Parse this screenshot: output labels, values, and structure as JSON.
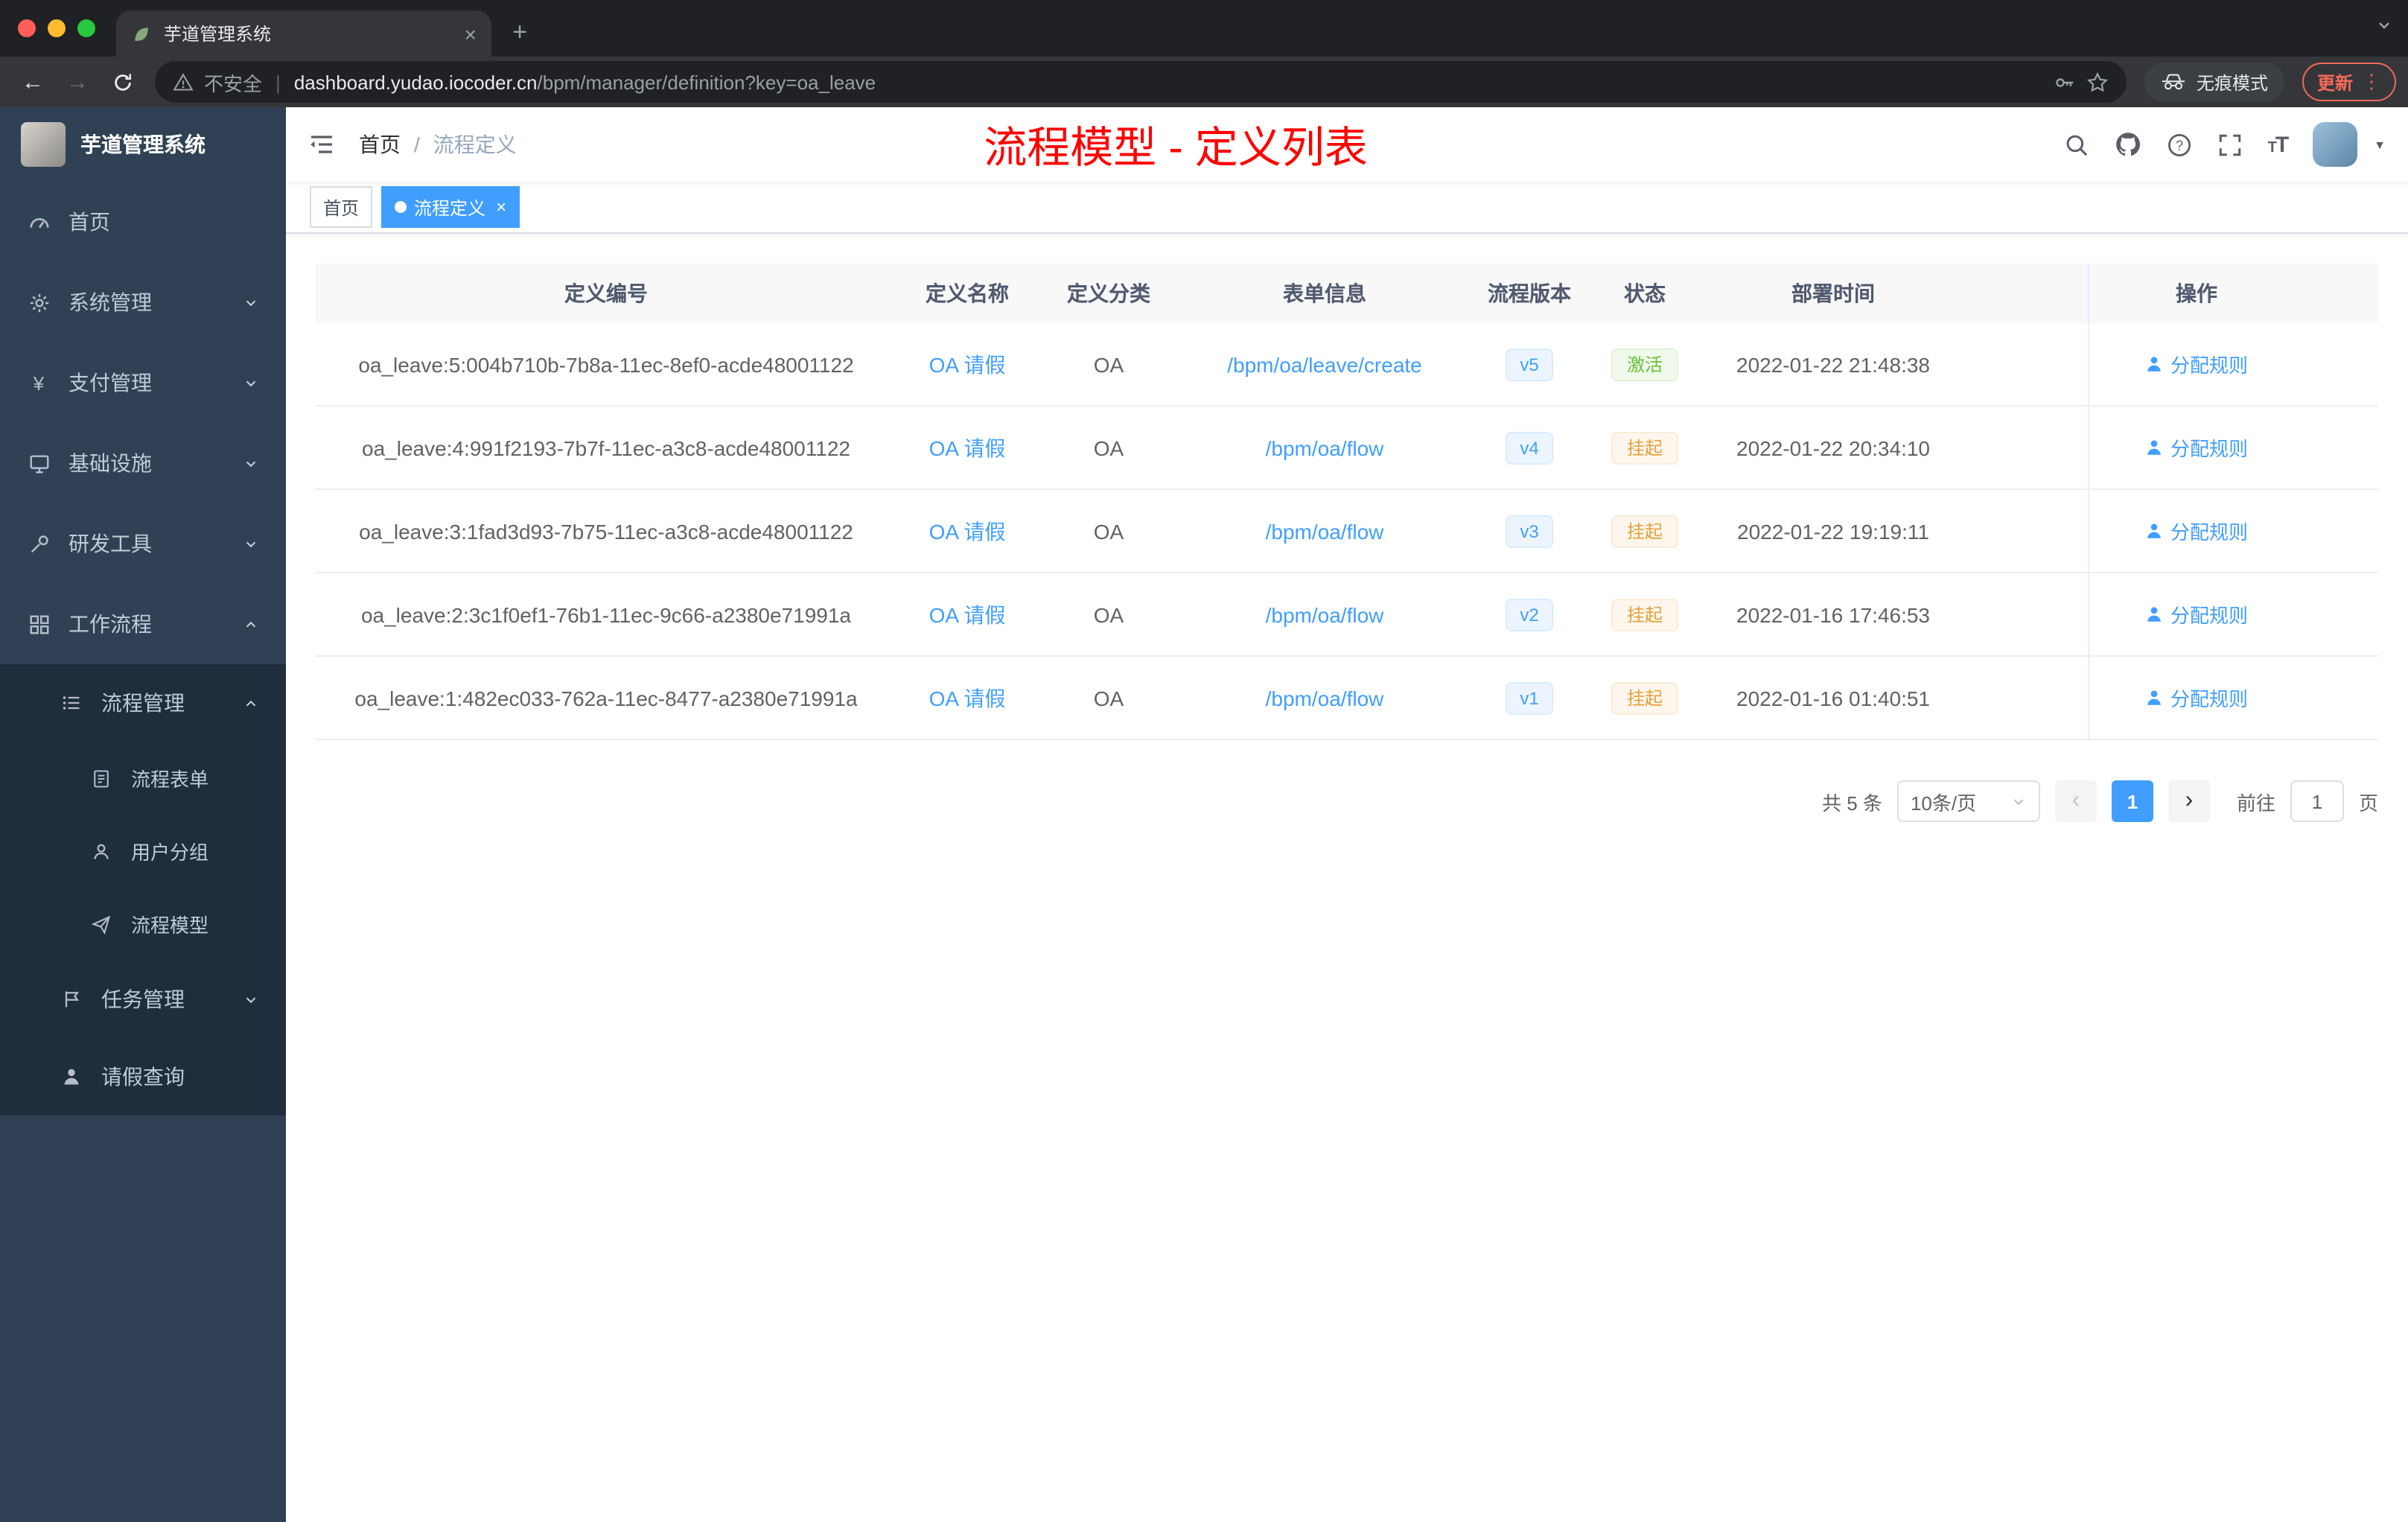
{
  "browser": {
    "tab_title": "芋道管理系统",
    "close_tab": "×",
    "new_tab": "+",
    "back": "←",
    "forward": "→",
    "security_label": "不安全",
    "url_host": "dashboard.yudao.iocoder.cn",
    "url_path": "/bpm/manager/definition?key=oa_leave",
    "incognito_label": "无痕模式",
    "update_label": "更新",
    "menu_dots": "⋮"
  },
  "sidebar": {
    "app_title": "芋道管理系统",
    "items": [
      {
        "label": "首页",
        "icon": "dashboard-icon"
      },
      {
        "label": "系统管理",
        "icon": "gear-icon"
      },
      {
        "label": "支付管理",
        "icon": "yen-icon"
      },
      {
        "label": "基础设施",
        "icon": "monitor-icon"
      },
      {
        "label": "研发工具",
        "icon": "tool-icon"
      },
      {
        "label": "工作流程",
        "icon": "workflow-icon"
      },
      {
        "label": "流程管理",
        "icon": "list-icon"
      },
      {
        "label": "流程表单",
        "icon": "form-icon"
      },
      {
        "label": "用户分组",
        "icon": "user-group-icon"
      },
      {
        "label": "流程模型",
        "icon": "send-icon"
      },
      {
        "label": "任务管理",
        "icon": "task-icon"
      },
      {
        "label": "请假查询",
        "icon": "person-icon"
      }
    ]
  },
  "navbar": {
    "breadcrumb": [
      "首页",
      "流程定义"
    ],
    "separator": "/",
    "annotation": "流程模型 - 定义列表"
  },
  "tags": [
    {
      "label": "首页"
    },
    {
      "label": "流程定义",
      "close": "×"
    }
  ],
  "table": {
    "headers": [
      "定义编号",
      "定义名称",
      "定义分类",
      "表单信息",
      "流程版本",
      "状态",
      "部署时间",
      "操作"
    ],
    "rows": [
      {
        "id": "oa_leave:5:004b710b-7b8a-11ec-8ef0-acde48001122",
        "name": "OA 请假",
        "category": "OA",
        "form": "/bpm/oa/leave/create",
        "version": "v5",
        "status": "激活",
        "status_type": "success",
        "deploy_time": "2022-01-22 21:48:38",
        "action": "分配规则"
      },
      {
        "id": "oa_leave:4:991f2193-7b7f-11ec-a3c8-acde48001122",
        "name": "OA 请假",
        "category": "OA",
        "form": "/bpm/oa/flow",
        "version": "v4",
        "status": "挂起",
        "status_type": "warning",
        "deploy_time": "2022-01-22 20:34:10",
        "action": "分配规则"
      },
      {
        "id": "oa_leave:3:1fad3d93-7b75-11ec-a3c8-acde48001122",
        "name": "OA 请假",
        "category": "OA",
        "form": "/bpm/oa/flow",
        "version": "v3",
        "status": "挂起",
        "status_type": "warning",
        "deploy_time": "2022-01-22 19:19:11",
        "action": "分配规则"
      },
      {
        "id": "oa_leave:2:3c1f0ef1-76b1-11ec-9c66-a2380e71991a",
        "name": "OA 请假",
        "category": "OA",
        "form": "/bpm/oa/flow",
        "version": "v2",
        "status": "挂起",
        "status_type": "warning",
        "deploy_time": "2022-01-16 17:46:53",
        "action": "分配规则"
      },
      {
        "id": "oa_leave:1:482ec033-762a-11ec-8477-a2380e71991a",
        "name": "OA 请假",
        "category": "OA",
        "form": "/bpm/oa/flow",
        "version": "v1",
        "status": "挂起",
        "status_type": "warning",
        "deploy_time": "2022-01-16 01:40:51",
        "action": "分配规则"
      }
    ]
  },
  "pagination": {
    "total": "共 5 条",
    "page_size": "10条/页",
    "prev": "‹",
    "next": "›",
    "current_page": "1",
    "goto_label": "前往",
    "goto_value": "1",
    "page_label": "页"
  },
  "colors": {
    "accent": "#409eff",
    "sidebar_bg": "#304156",
    "submenu_bg": "#1f2d3d",
    "success": "#67c23a",
    "warning": "#e6a23c",
    "annotation_red": "#ff0000"
  }
}
